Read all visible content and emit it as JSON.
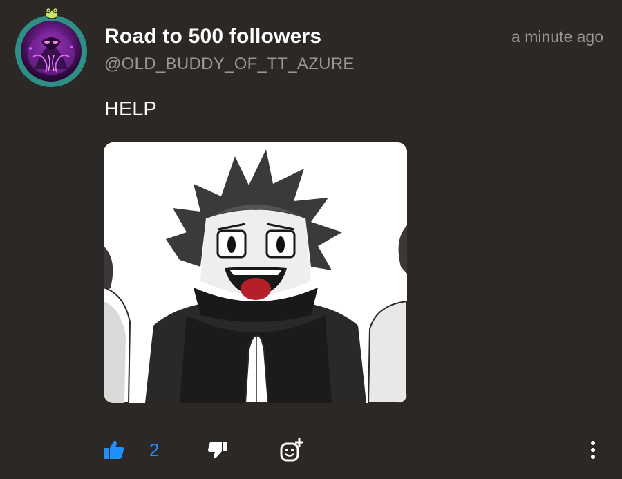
{
  "post": {
    "title": "Road to 500 followers",
    "handle": "@OLD_BUDDY_OF_TT_AZURE",
    "timestamp": "a minute ago",
    "body": "HELP"
  },
  "actions": {
    "like_count": "2",
    "like_icon": "thumbs-up-icon",
    "dislike_icon": "thumbs-down-icon",
    "react_icon": "add-reaction-icon",
    "more_icon": "vertical-ellipsis-icon"
  },
  "colors": {
    "background": "#2b2826",
    "accent": "#1e90ff",
    "secondary_text": "#9c9794",
    "avatar_ring": "#2e8f86"
  }
}
